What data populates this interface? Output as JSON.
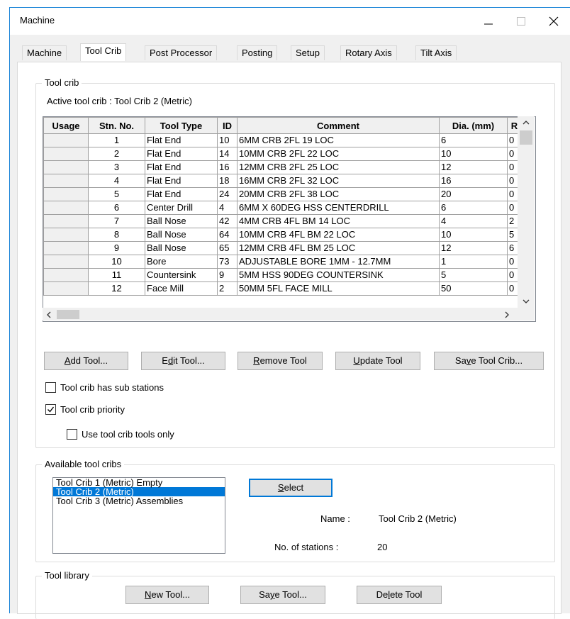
{
  "window": {
    "title": "Machine"
  },
  "tabs": [
    "Machine",
    "Tool Crib",
    "Post Processor",
    "Posting",
    "Setup",
    "Rotary Axis",
    "Tilt Axis"
  ],
  "active_tab": "Tool Crib",
  "tool_crib": {
    "group_title": "Tool crib",
    "active_label": "Active tool crib :",
    "active_value": "Tool Crib 2 (Metric)",
    "columns": [
      "Usage",
      "Stn. No.",
      "Tool Type",
      "ID",
      "Comment",
      "Dia. (mm)",
      "R"
    ],
    "rows": [
      [
        "",
        "1",
        "Flat End",
        "10",
        "6MM CRB 2FL 19 LOC",
        "6",
        "0"
      ],
      [
        "",
        "2",
        "Flat End",
        "14",
        "10MM CRB 2FL 22 LOC",
        "10",
        "0"
      ],
      [
        "",
        "3",
        "Flat End",
        "16",
        "12MM CRB 2FL 25 LOC",
        "12",
        "0"
      ],
      [
        "",
        "4",
        "Flat End",
        "18",
        "16MM CRB 2FL 32 LOC",
        "16",
        "0"
      ],
      [
        "",
        "5",
        "Flat End",
        "24",
        "20MM CRB 2FL 38 LOC",
        "20",
        "0"
      ],
      [
        "",
        "6",
        "Center Drill",
        "4",
        "6MM X 60DEG HSS CENTERDRILL",
        "6",
        "0"
      ],
      [
        "",
        "7",
        "Ball Nose",
        "42",
        "4MM CRB 4FL BM 14 LOC",
        "4",
        "2"
      ],
      [
        "",
        "8",
        "Ball Nose",
        "64",
        "10MM CRB 4FL BM 22 LOC",
        "10",
        "5"
      ],
      [
        "",
        "9",
        "Ball Nose",
        "65",
        "12MM CRB 4FL BM 25 LOC",
        "12",
        "6"
      ],
      [
        "",
        "10",
        "Bore",
        "73",
        "ADJUSTABLE BORE 1MM - 12.7MM",
        "1",
        "0"
      ],
      [
        "",
        "11",
        "Countersink",
        "9",
        "5MM HSS 90DEG COUNTERSINK",
        "5",
        "0"
      ],
      [
        "",
        "12",
        "Face Mill",
        "2",
        "50MM 5FL FACE MILL",
        "50",
        "0"
      ]
    ],
    "buttons": {
      "add": {
        "pre": "",
        "key": "A",
        "post": "dd Tool..."
      },
      "edit": {
        "pre": "E",
        "key": "d",
        "post": "it Tool..."
      },
      "remove": {
        "pre": "",
        "key": "R",
        "post": "emove Tool"
      },
      "update": {
        "pre": "",
        "key": "U",
        "post": "pdate Tool"
      },
      "save": {
        "pre": "Sa",
        "key": "v",
        "post": "e Tool Crib..."
      }
    },
    "checkboxes": {
      "sub_stations": {
        "label": "Tool crib has sub stations",
        "checked": false
      },
      "priority": {
        "label": "Tool crib priority",
        "checked": true
      },
      "use_only": {
        "label": "Use tool crib tools only",
        "checked": false
      }
    }
  },
  "available": {
    "group_title": "Available tool cribs",
    "items": [
      "Tool Crib 1 (Metric) Empty",
      "Tool Crib 2 (Metric)",
      "Tool Crib 3 (Metric) Assemblies"
    ],
    "selected_index": 1,
    "select_button": {
      "pre": "",
      "key": "S",
      "post": "elect"
    },
    "name_label": "Name :",
    "name_value": "Tool Crib 2 (Metric)",
    "stations_label": "No. of stations :",
    "stations_value": "20"
  },
  "library": {
    "group_title": "Tool library",
    "new": {
      "pre": "",
      "key": "N",
      "post": "ew Tool..."
    },
    "save": {
      "pre": "Sa",
      "key": "y",
      "post": "e Tool..."
    },
    "delete": {
      "pre": "De",
      "key": "l",
      "post": "ete Tool"
    }
  }
}
